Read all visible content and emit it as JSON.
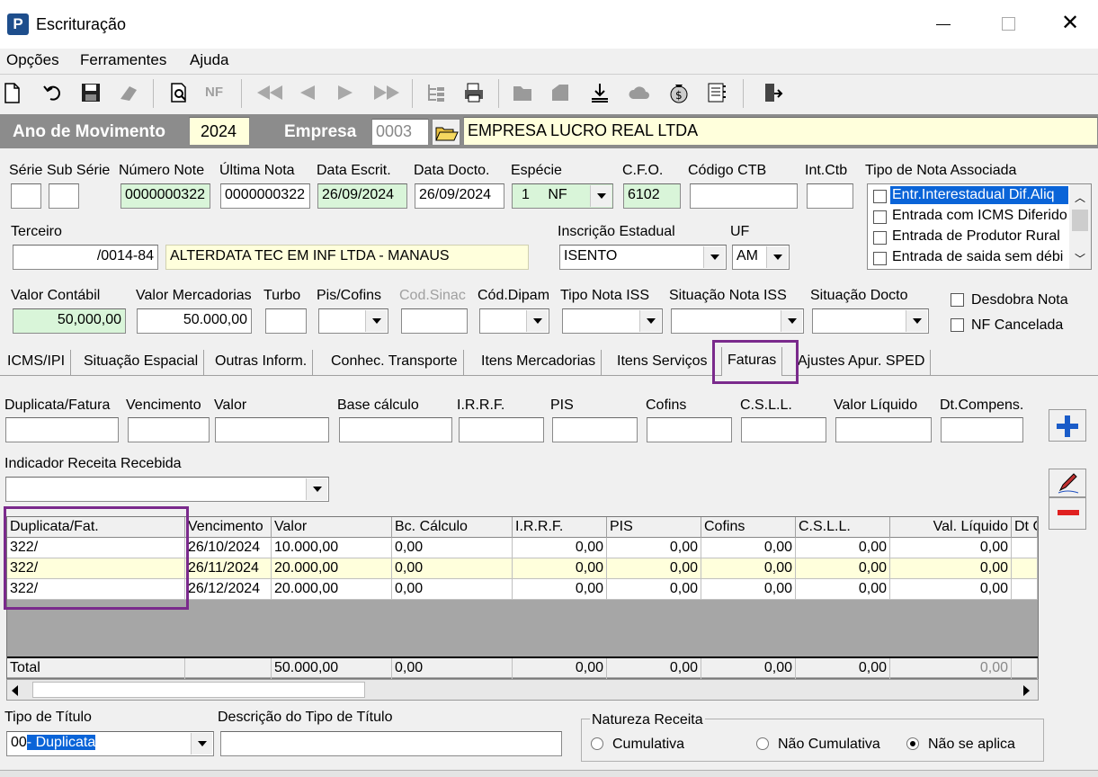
{
  "window": {
    "title": "Escrituração",
    "app_icon_letter": "P"
  },
  "menu": [
    "Opções",
    "Ferramentes",
    "Ajuda"
  ],
  "header_bar": {
    "ano_label": "Ano de Movimento",
    "ano_value": "2024",
    "empresa_label": "Empresa",
    "empresa_code": "0003",
    "empresa_name": "EMPRESA LUCRO REAL LTDA"
  },
  "nota": {
    "serie_label": "Série",
    "subserie_label": "Sub Série",
    "numero_label": "Número Note",
    "numero_value": "0000000322",
    "ultima_label": "Última Nota",
    "ultima_value": "0000000322",
    "data_escrit_label": "Data Escrit.",
    "data_escrit_value": "26/09/2024",
    "data_docto_label": "Data Docto.",
    "data_docto_value": "26/09/2024",
    "especie_label": "Espécie",
    "especie_num": "1",
    "especie_value": "NF",
    "cfo_label": "C.F.O.",
    "cfo_value": "6102",
    "codigo_ctb_label": "Código CTB",
    "int_ctb_label": "Int.Ctb",
    "tipo_nota_label": "Tipo de Nota Associada",
    "tipo_nota_items": [
      "Entr.Interestadual Dif.Aliq",
      "Entrada com ICMS Diferido",
      "Entrada de Produtor Rural",
      "Entrada de saida sem débi"
    ]
  },
  "terceiro": {
    "label": "Terceiro",
    "cnpj": "/0014-84",
    "name": "ALTERDATA TEC EM INF LTDA - MANAUS",
    "ie_label": "Inscrição Estadual",
    "ie_value": "ISENTO",
    "uf_label": "UF",
    "uf_value": "AM"
  },
  "valores": {
    "contabil_label": "Valor Contábil",
    "contabil_value": "50,000,00",
    "mercadorias_label": "Valor Mercadorias",
    "mercadorias_value": "50.000,00",
    "turbo_label": "Turbo",
    "pis_label": "Pis/Cofins",
    "sinac_label": "Cod.Sinac",
    "dipam_label": "Cód.Dipam",
    "tipo_iss_label": "Tipo Nota ISS",
    "sit_iss_label": "Situação Nota ISS",
    "sit_docto_label": "Situação Docto",
    "desdobra_label": "Desdobra Nota",
    "cancelada_label": "NF Cancelada"
  },
  "tabs": [
    "ICMS/IPI",
    "Situação Espacial",
    "Outras Inform.",
    "Conhec. Transporte",
    "Itens Mercadorias",
    "Itens Serviços",
    "Faturas",
    "Ajustes Apur. SPED"
  ],
  "fatura_form": {
    "labels": [
      "Duplicata/Fatura",
      "Vencimento",
      "Valor",
      "Base cálculo",
      "I.R.R.F.",
      "PIS",
      "Cofins",
      "C.S.L.L.",
      "Valor Líquido",
      "Dt.Compens."
    ],
    "indicador_label": "Indicador Receita Recebida"
  },
  "grid": {
    "columns": [
      "Duplicata/Fat.",
      "Vencimento",
      "Valor",
      "Bc. Cálculo",
      "I.R.R.F.",
      "PIS",
      "Cofins",
      "C.S.L.L.",
      "Val. Líquido",
      "Dt C"
    ],
    "rows": [
      [
        "322/",
        "26/10/2024",
        "10.000,00",
        "0,00",
        "0,00",
        "0,00",
        "0,00",
        "0,00",
        "0,00"
      ],
      [
        "322/",
        "26/11/2024",
        "20.000,00",
        "0,00",
        "0,00",
        "0,00",
        "0,00",
        "0,00",
        "0,00"
      ],
      [
        "322/",
        "26/12/2024",
        "20.000,00",
        "0,00",
        "0,00",
        "0,00",
        "0,00",
        "0,00",
        "0,00"
      ]
    ],
    "total": [
      "Total",
      "",
      "50.000,00",
      "0,00",
      "0,00",
      "0,00",
      "0,00",
      "0,00",
      "0,00"
    ]
  },
  "titulo": {
    "tipo_label": "Tipo de Título",
    "tipo_code": "00",
    "tipo_value": "- Duplicata",
    "desc_label": "Descrição do Tipo de Título"
  },
  "natureza": {
    "label": "Natureza Receita",
    "options": [
      "Cumulativa",
      "Não Cumulativa",
      "Não se aplica"
    ],
    "selected": "Não se aplica"
  },
  "colors": {
    "accent_purple": "#7a2a8c",
    "header_gray": "#8c8c8c",
    "field_green": "#d9f5d9",
    "field_yellow": "#ffffdc"
  }
}
